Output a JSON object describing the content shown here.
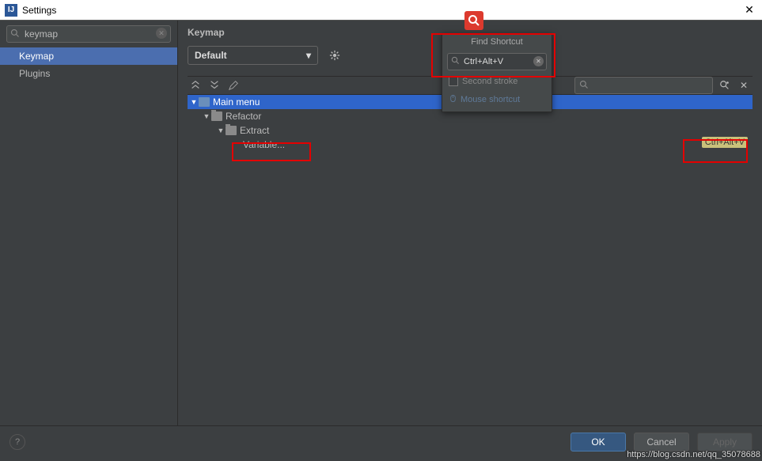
{
  "window": {
    "title": "Settings",
    "app_icon_text": "IJ"
  },
  "sidebar": {
    "search_value": "keymap",
    "items": [
      {
        "label": "Keymap",
        "selected": true
      },
      {
        "label": "Plugins",
        "selected": false
      }
    ]
  },
  "panel": {
    "title": "Keymap",
    "dropdown_value": "Default",
    "right_search_placeholder": "",
    "tree": {
      "l0": "Main menu",
      "l1": "Refactor",
      "l2": "Extract",
      "l3": "Variable...",
      "shortcut": "Ctrl+Alt+V"
    }
  },
  "popup": {
    "title": "Find Shortcut",
    "input_value": "Ctrl+Alt+V",
    "second_stroke_label": "Second stroke",
    "mouse_label": "Mouse shortcut"
  },
  "footer": {
    "ok": "OK",
    "cancel": "Cancel",
    "apply": "Apply"
  },
  "watermark": "https://blog.csdn.net/qq_35078688"
}
